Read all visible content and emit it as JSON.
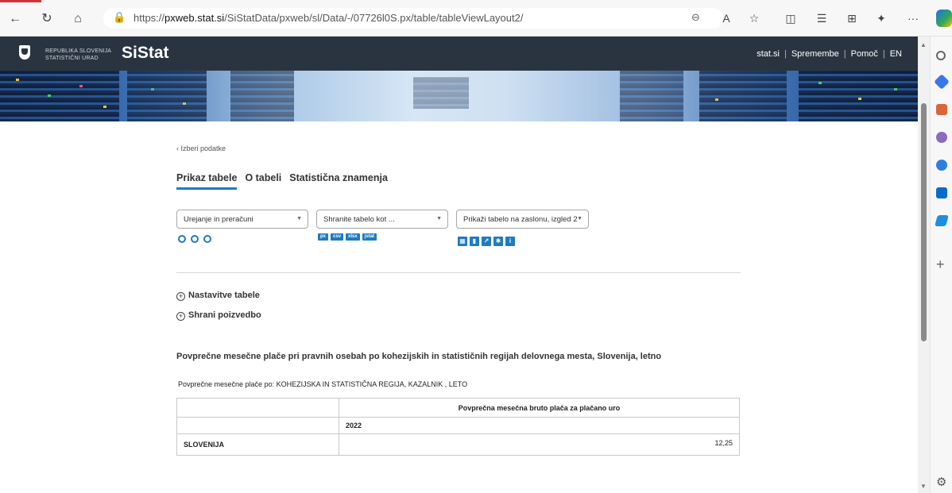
{
  "browser": {
    "url_prefix": "https://",
    "url_host": "pxweb.stat.si",
    "url_path": "/SiStatData/pxweb/sl/Data/-/07726l0S.px/table/tableViewLayout2/",
    "icons": [
      "back-icon",
      "refresh-icon",
      "home-icon",
      "lock-icon",
      "zoom-icon",
      "read-aloud-icon",
      "favorite-icon",
      "split-screen-icon",
      "favorites-list-icon",
      "collections-icon",
      "extensions-icon",
      "more-icon"
    ],
    "more": "···"
  },
  "header": {
    "republika_line1": "REPUBLIKA SLOVENIJA",
    "republika_line2": "STATISTIČNI URAD",
    "brand": "SiStat",
    "links": [
      "stat.si",
      "Spremembe",
      "Pomoč",
      "EN"
    ],
    "separator": "|"
  },
  "page": {
    "back_link": "‹  Izberi podatke",
    "tabs": [
      {
        "label": "Prikaz tabele",
        "active": true
      },
      {
        "label": "O tabeli",
        "active": false
      },
      {
        "label": "Statistična znamenja",
        "active": false
      }
    ],
    "dropdowns": [
      {
        "label": "Urejanje in preračuni"
      },
      {
        "label": "Shranite tabelo kot ..."
      },
      {
        "label": "Prikaži tabelo na zaslonu, izgled 2"
      }
    ],
    "formats": [
      "px",
      "csv",
      "xlsx",
      "jstat"
    ],
    "expanders": [
      {
        "label": "Nastavitve tabele"
      },
      {
        "label": "Shrani poizvedbo"
      }
    ],
    "table_title": "Povprečne mesečne plače pri pravnih osebah po kohezijskih in statističnih regijah delovnega mesta, Slovenija, letno",
    "table_subtitle": "Povprečne mesečne plače po: KOHEZIJSKA IN STATISTIČNA REGIJA, KAZALNIK , LETO",
    "table": {
      "measure": "Povprečna mesečna bruto plača za plačano uro",
      "year": "2022",
      "rows": [
        {
          "region": "SLOVENIJA",
          "value": "12,25"
        }
      ]
    }
  }
}
